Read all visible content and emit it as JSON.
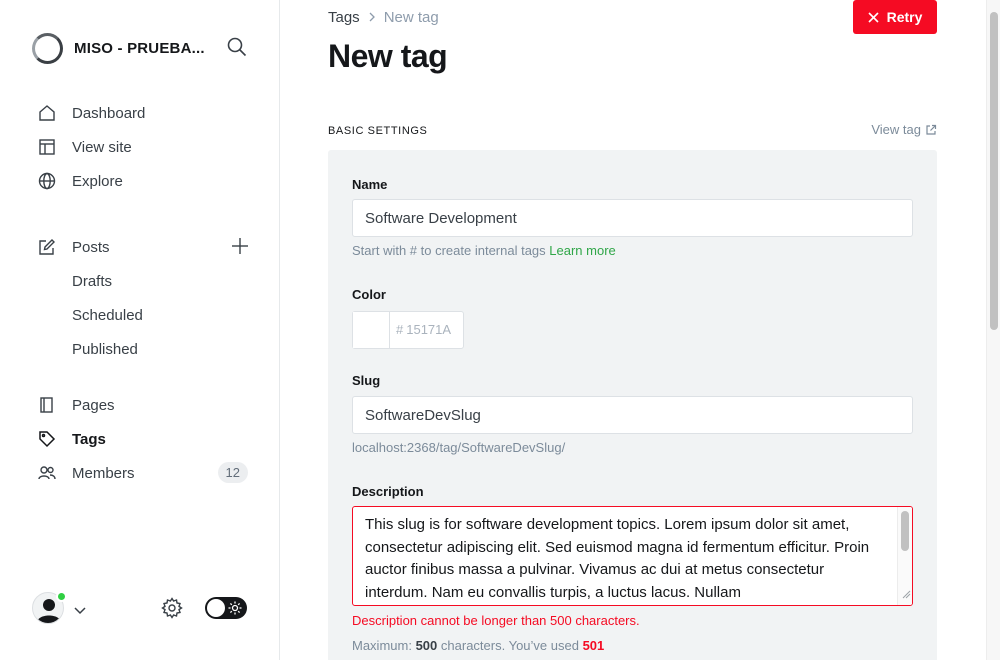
{
  "sidebar": {
    "site_name": "MISO - PRUEBA...",
    "nav_primary": [
      {
        "label": "Dashboard",
        "icon": "home-icon"
      },
      {
        "label": "View site",
        "icon": "layout-icon"
      },
      {
        "label": "Explore",
        "icon": "globe-icon"
      }
    ],
    "posts": {
      "label": "Posts",
      "sub": [
        "Drafts",
        "Scheduled",
        "Published"
      ]
    },
    "nav_secondary": [
      {
        "label": "Pages",
        "icon": "pages-icon"
      },
      {
        "label": "Tags",
        "icon": "tag-icon",
        "active": true
      },
      {
        "label": "Members",
        "icon": "members-icon",
        "count": "12"
      }
    ]
  },
  "header": {
    "breadcrumb_parent": "Tags",
    "breadcrumb_separator": ">",
    "breadcrumb_current": "New tag",
    "title": "New tag",
    "retry_label": "Retry"
  },
  "form": {
    "section_title": "BASIC SETTINGS",
    "view_tag_label": "View tag",
    "name_label": "Name",
    "name_value": "Software Development",
    "name_hint": "Start with # to create internal tags",
    "name_hint_link": "Learn more",
    "color_label": "Color",
    "color_hash": "#",
    "color_placeholder": "15171A",
    "slug_label": "Slug",
    "slug_value": "SoftwareDevSlug",
    "slug_url": "localhost:2368/tag/SoftwareDevSlug/",
    "description_label": "Description",
    "description_value": "This slug is for software development topics. Lorem ipsum dolor sit amet, consectetur adipiscing elit. Sed euismod magna id fermentum efficitur. Proin auctor finibus massa a pulvinar. Vivamus ac dui at metus consectetur interdum. Nam eu convallis turpis, a luctus lacus. Nullam",
    "description_error": "Description cannot be longer than 500 characters.",
    "counter_prefix": "Maximum:",
    "counter_max": "500",
    "counter_mid": "characters. You’ve used",
    "counter_used": "501"
  },
  "colors": {
    "accent_red": "#f50b23",
    "link_green": "#30a648",
    "online_green": "#30cf43"
  }
}
